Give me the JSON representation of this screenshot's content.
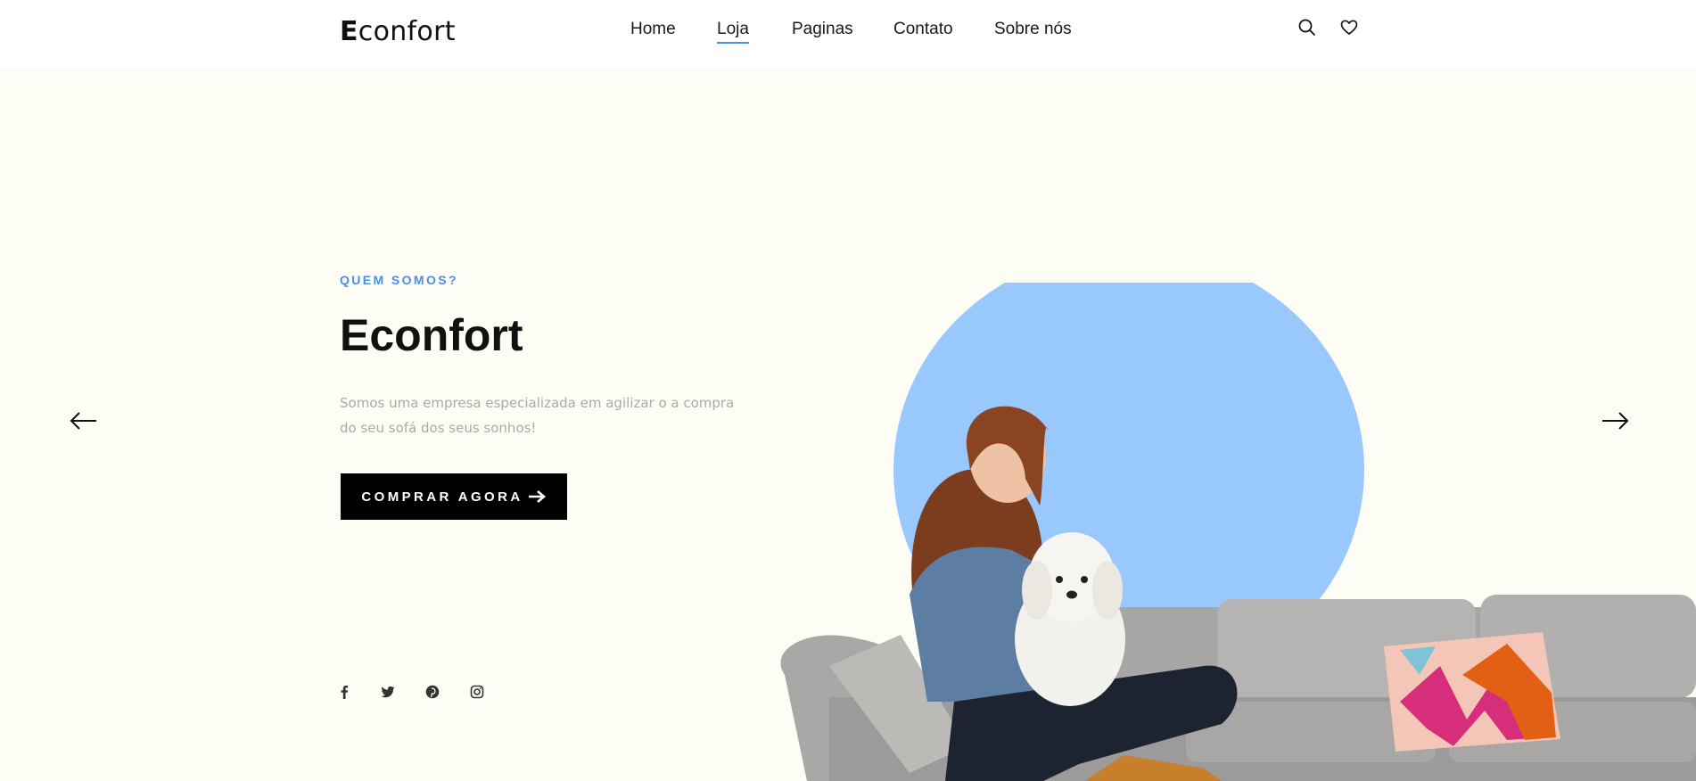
{
  "header": {
    "logo_first": "E",
    "logo_rest": "confort",
    "nav": [
      {
        "label": "Home"
      },
      {
        "label": "Loja",
        "active": true
      },
      {
        "label": "Paginas"
      },
      {
        "label": "Contato"
      },
      {
        "label": "Sobre nós"
      }
    ],
    "icons": [
      "search-icon",
      "heart-icon"
    ]
  },
  "hero": {
    "eyebrow": "QUEM SOMOS?",
    "title": "Econfort",
    "description": "Somos uma empresa especializada em agilizar o a compra do seu sofá dos seus sonhos!",
    "cta_label": "COMPRAR AGORA",
    "cta_icon": "arrow-right-icon",
    "prev_icon": "arrow-left-icon",
    "next_icon": "arrow-right-icon",
    "social_icons": [
      "facebook-icon",
      "twitter-icon",
      "pinterest-icon",
      "instagram-icon"
    ]
  },
  "colors": {
    "accent": "#4a90e2",
    "hero_bg": "#fefdf5",
    "circle": "#99c9fc",
    "button_bg": "#000000",
    "sofa": "#a7a6a4"
  }
}
